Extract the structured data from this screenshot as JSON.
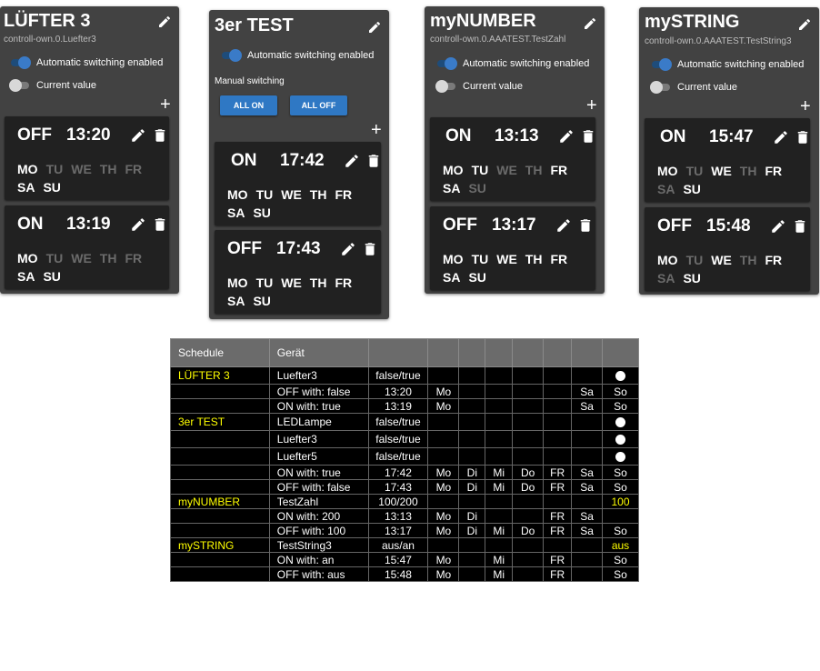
{
  "cards": [
    {
      "title": "LÜFTER 3",
      "subtitle": "controll-own.0.Luefter3",
      "auto_label": "Automatic switching enabled",
      "value_label": "Current value",
      "events": [
        {
          "state": "OFF",
          "time": "13:20",
          "days": [
            [
              "MO",
              1
            ],
            [
              "TU",
              0
            ],
            [
              "WE",
              0
            ],
            [
              "TH",
              0
            ],
            [
              "FR",
              0
            ],
            [
              "SA",
              1
            ],
            [
              "SU",
              1
            ]
          ]
        },
        {
          "state": "ON",
          "time": "13:19",
          "days": [
            [
              "MO",
              1
            ],
            [
              "TU",
              0
            ],
            [
              "WE",
              0
            ],
            [
              "TH",
              0
            ],
            [
              "FR",
              0
            ],
            [
              "SA",
              1
            ],
            [
              "SU",
              1
            ]
          ]
        }
      ]
    },
    {
      "title": "3er TEST",
      "auto_label": "Automatic switching enabled",
      "manual_label": "Manual switching",
      "all_on": "ALL ON",
      "all_off": "ALL OFF",
      "events": [
        {
          "state": "ON",
          "time": "17:42",
          "days": [
            [
              "MO",
              1
            ],
            [
              "TU",
              1
            ],
            [
              "WE",
              1
            ],
            [
              "TH",
              1
            ],
            [
              "FR",
              1
            ],
            [
              "SA",
              1
            ],
            [
              "SU",
              1
            ]
          ]
        },
        {
          "state": "OFF",
          "time": "17:43",
          "days": [
            [
              "MO",
              1
            ],
            [
              "TU",
              1
            ],
            [
              "WE",
              1
            ],
            [
              "TH",
              1
            ],
            [
              "FR",
              1
            ],
            [
              "SA",
              1
            ],
            [
              "SU",
              1
            ]
          ]
        }
      ]
    },
    {
      "title": "myNUMBER",
      "subtitle": "controll-own.0.AAATEST.TestZahl",
      "auto_label": "Automatic switching enabled",
      "value_label": "Current value",
      "events": [
        {
          "state": "ON",
          "time": "13:13",
          "days": [
            [
              "MO",
              1
            ],
            [
              "TU",
              1
            ],
            [
              "WE",
              0
            ],
            [
              "TH",
              0
            ],
            [
              "FR",
              1
            ],
            [
              "SA",
              1
            ],
            [
              "SU",
              0
            ]
          ]
        },
        {
          "state": "OFF",
          "time": "13:17",
          "days": [
            [
              "MO",
              1
            ],
            [
              "TU",
              1
            ],
            [
              "WE",
              1
            ],
            [
              "TH",
              1
            ],
            [
              "FR",
              1
            ],
            [
              "SA",
              1
            ],
            [
              "SU",
              1
            ]
          ]
        }
      ]
    },
    {
      "title": "mySTRING",
      "subtitle": "controll-own.0.AAATEST.TestString3",
      "auto_label": "Automatic switching enabled",
      "value_label": "Current value",
      "events": [
        {
          "state": "ON",
          "time": "15:47",
          "days": [
            [
              "MO",
              1
            ],
            [
              "TU",
              0
            ],
            [
              "WE",
              1
            ],
            [
              "TH",
              0
            ],
            [
              "FR",
              1
            ],
            [
              "SA",
              0
            ],
            [
              "SU",
              1
            ]
          ]
        },
        {
          "state": "OFF",
          "time": "15:48",
          "days": [
            [
              "MO",
              1
            ],
            [
              "TU",
              0
            ],
            [
              "WE",
              1
            ],
            [
              "TH",
              0
            ],
            [
              "FR",
              1
            ],
            [
              "SA",
              0
            ],
            [
              "SU",
              1
            ]
          ]
        }
      ]
    }
  ],
  "table": {
    "headers": [
      "Schedule",
      "Gerät",
      "",
      "",
      "",
      "",
      "",
      "",
      "",
      ""
    ],
    "rows": [
      [
        "LÜFTER 3",
        "Luefter3",
        "false/true",
        "",
        "",
        "",
        "",
        "",
        "",
        "●"
      ],
      [
        "",
        "OFF with: false",
        "13:20",
        "Mo",
        "",
        "",
        "",
        "",
        "Sa",
        "So"
      ],
      [
        "",
        "ON with: true",
        "13:19",
        "Mo",
        "",
        "",
        "",
        "",
        "Sa",
        "So"
      ],
      [
        "3er TEST",
        "LEDLampe",
        "false/true",
        "",
        "",
        "",
        "",
        "",
        "",
        "●"
      ],
      [
        "",
        "Luefter3",
        "false/true",
        "",
        "",
        "",
        "",
        "",
        "",
        "●"
      ],
      [
        "",
        "Luefter5",
        "false/true",
        "",
        "",
        "",
        "",
        "",
        "",
        "●"
      ],
      [
        "",
        "ON with: true",
        "17:42",
        "Mo",
        "Di",
        "Mi",
        "Do",
        "FR",
        "Sa",
        "So"
      ],
      [
        "",
        "OFF with: false",
        "17:43",
        "Mo",
        "Di",
        "Mi",
        "Do",
        "FR",
        "Sa",
        "So"
      ],
      [
        "myNUMBER",
        "TestZahl",
        "100/200",
        "",
        "",
        "",
        "",
        "",
        "",
        "100"
      ],
      [
        "",
        "ON with: 200",
        "13:13",
        "Mo",
        "Di",
        "",
        "",
        "FR",
        "Sa",
        ""
      ],
      [
        "",
        "OFF with: 100",
        "13:17",
        "Mo",
        "Di",
        "Mi",
        "Do",
        "FR",
        "Sa",
        "So"
      ],
      [
        "mySTRING",
        "TestString3",
        "aus/an",
        "",
        "",
        "",
        "",
        "",
        "",
        "aus"
      ],
      [
        "",
        "ON with: an",
        "15:47",
        "Mo",
        "",
        "Mi",
        "",
        "FR",
        "",
        "So"
      ],
      [
        "",
        "OFF with: aus",
        "15:48",
        "Mo",
        "",
        "Mi",
        "",
        "FR",
        "",
        "So"
      ]
    ]
  }
}
